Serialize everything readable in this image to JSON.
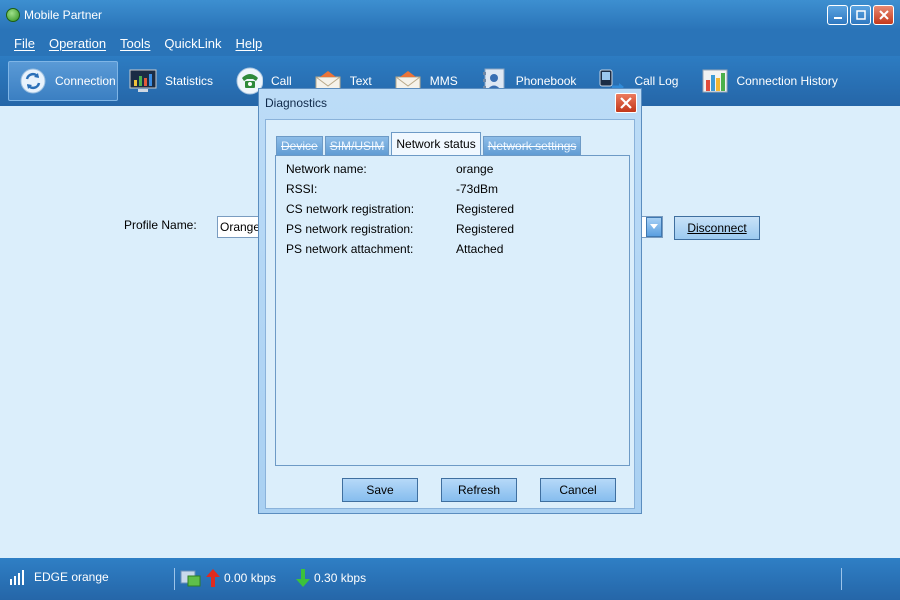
{
  "window": {
    "title": "Mobile Partner"
  },
  "menu": {
    "file": "File",
    "operation": "Operation",
    "tools": "Tools",
    "quicklink": "QuickLink",
    "help": "Help"
  },
  "toolbar": {
    "connection": "Connection",
    "statistics": "Statistics",
    "call": "Call",
    "text": "Text",
    "mms": "MMS",
    "phonebook": "Phonebook",
    "call_log": "Call Log",
    "connection_history": "Connection History"
  },
  "main": {
    "profile_label": "Profile Name:",
    "profile_value": "Orange.",
    "disconnect_label": "Disconnect"
  },
  "dialog": {
    "title": "Diagnostics",
    "tabs": [
      "Device",
      "SIM/USIM",
      "Network status",
      "Network settings"
    ],
    "active_tab": "Network status",
    "rows": [
      {
        "label": "Network name:",
        "value": "orange"
      },
      {
        "label": "RSSI:",
        "value": "-73dBm"
      },
      {
        "label": "CS network registration:",
        "value": "Registered"
      },
      {
        "label": "PS network registration:",
        "value": "Registered"
      },
      {
        "label": "PS network attachment:",
        "value": "Attached"
      }
    ],
    "buttons": {
      "save": "Save",
      "refresh": "Refresh",
      "cancel": "Cancel"
    }
  },
  "status": {
    "network": "EDGE orange",
    "upload": "0.00 kbps",
    "download": "0.30 kbps"
  },
  "colors": {
    "accent": "#2a74b8",
    "background": "#dbeefb",
    "close_red": "#c4391c"
  }
}
